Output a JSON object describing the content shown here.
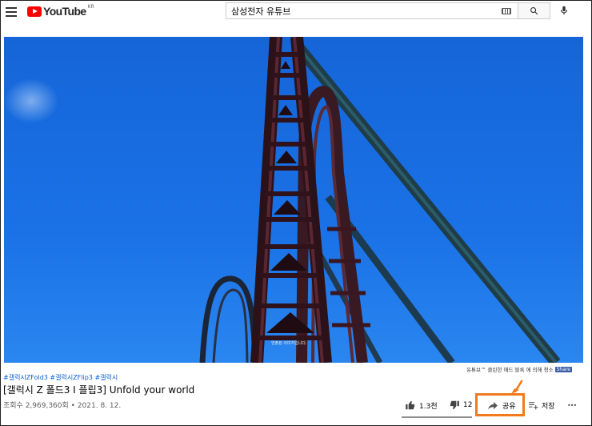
{
  "header": {
    "logo_text": "YouTube",
    "country": "KR",
    "search_value": "삼성전자 유튜브"
  },
  "video": {
    "caption": "연출된 이미지입니다.",
    "promo_text": "유튜브™ 클린한 애드 블록 에 의해 청소",
    "promo_share": "Share"
  },
  "info": {
    "hashtags": [
      "#갤럭시ZFold3",
      "#갤럭시ZFlip3",
      "#갤럭시"
    ],
    "title": "[갤럭시 Z 폴드3 I 플립3] Unfold your world",
    "meta": "조회수 2,969,360회 • 2021. 8. 12."
  },
  "actions": {
    "like_count": "1.3천",
    "dislike_count": "12",
    "share_label": "공유",
    "save_label": "저장",
    "more_label": "•••"
  },
  "colors": {
    "highlight": "#f07a1c",
    "sky": "#1a72e6",
    "link": "#065fd4"
  }
}
